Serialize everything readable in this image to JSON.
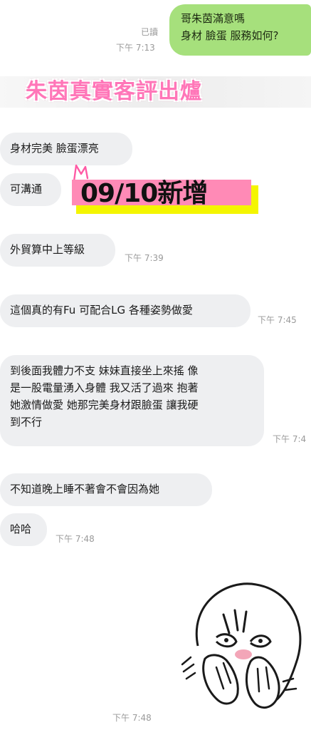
{
  "outgoing": {
    "read_label": "已讀",
    "time": "下午 7:13",
    "lines": [
      "哥朱茵滿意嗎",
      "身材 臉蛋 服務如何?"
    ]
  },
  "banner": {
    "title": "朱茵真實客評出爐"
  },
  "new_badge": {
    "text": "09/10新增"
  },
  "messages": [
    {
      "lines": [
        "身材完美 臉蛋漂亮"
      ],
      "time": ""
    },
    {
      "lines": [
        "可溝通"
      ],
      "time": ""
    },
    {
      "lines": [
        "外貿算中上等級"
      ],
      "time": "下午 7:39"
    },
    {
      "lines": [
        "這個真的有Fu 可配合LG 各種姿勢做愛"
      ],
      "time": "下午 7:45"
    },
    {
      "lines": [
        "到後面我體力不支 妹妹直接坐上來搖 像",
        "是一股電量湧入身體 我又活了過來 抱著",
        "她激情做愛 她那完美身材跟臉蛋 讓我硬",
        "到不行"
      ],
      "time": "下午 7:4"
    },
    {
      "lines": [
        "不知道晚上睡不著會不會因為她"
      ],
      "time": ""
    },
    {
      "lines": [
        "哈哈"
      ],
      "time": "下午 7:48"
    }
  ],
  "sticker": {
    "name": "shy-face-sticker",
    "time": "下午 7:48"
  },
  "colors": {
    "outgoing_bubble": "#a6e07c",
    "incoming_bubble": "#eeeff1",
    "banner_text": "#ff76b8",
    "badge_yellow": "#f4f500",
    "badge_pink": "#ff8ab6"
  }
}
